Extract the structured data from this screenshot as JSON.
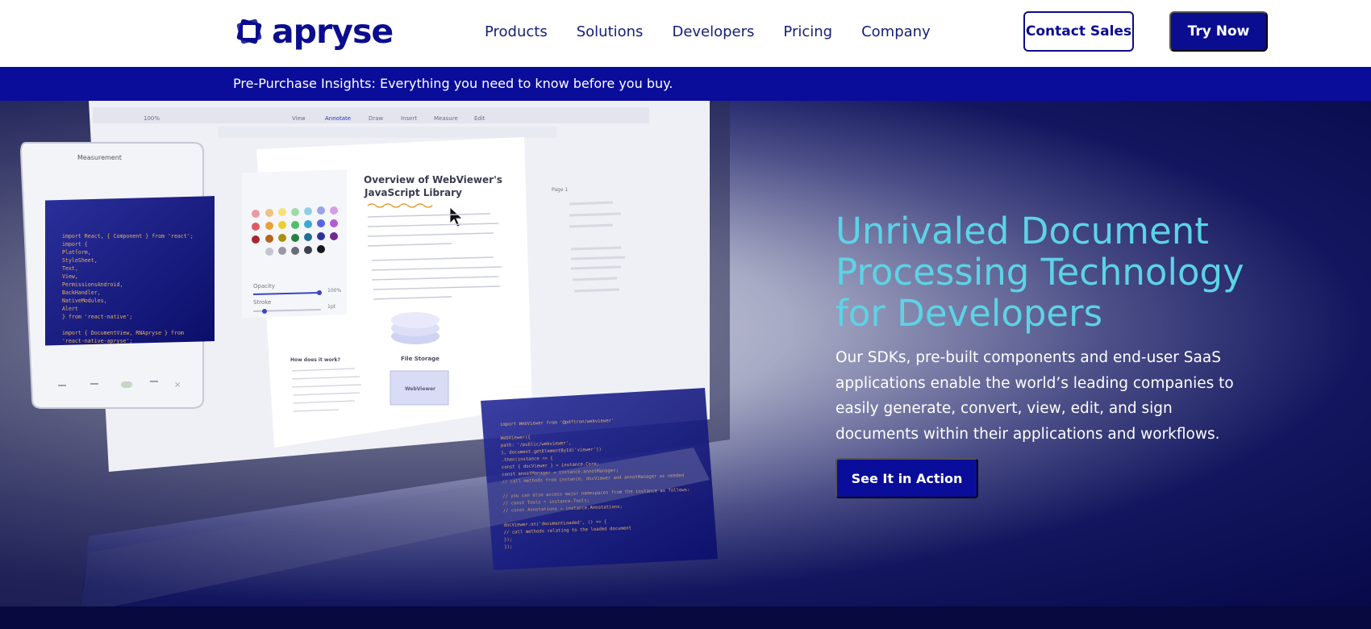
{
  "brand": {
    "name": "apryse",
    "color": "#0a0d8f"
  },
  "nav": {
    "items": [
      "Products",
      "Solutions",
      "Developers",
      "Pricing",
      "Company"
    ]
  },
  "header_buttons": {
    "contact": "Contact Sales",
    "try": "Try Now"
  },
  "banner": {
    "text": "Pre-Purchase Insights: Everything you need to know before you buy."
  },
  "hero": {
    "title_lines": [
      "Unrivaled Document",
      "Processing Technology",
      "for Developers"
    ],
    "description": "Our SDKs, pre-built components and end-user SaaS applications enable the world’s leading companies to easily generate, convert, view, edit, and sign documents within their applications and workflows.",
    "cta": "See It in Action",
    "title_color": "#5dd3e6"
  },
  "illustration": {
    "doc_title_1": "Overview of WebViewer's",
    "doc_title_2": "JavaScript Library",
    "panel_label": "Measurement",
    "toolbar_tabs": [
      "View",
      "Annotate",
      "Draw",
      "Insert",
      "Measure",
      "Edit"
    ],
    "zoom": "100%",
    "file_storage": "File Storage",
    "webviewer": "WebViewer",
    "how_it_works": "How does it work?",
    "page_label": "Page 1",
    "opacity_label": "Opacity",
    "stroke_label": "Stroke",
    "opacity_value": "100%",
    "stroke_value": "1pt",
    "code_left": [
      "import React, { Component } from 'react';",
      "import {",
      "  Platform,",
      "  StyleSheet,",
      "  Text,",
      "  View,",
      "  PermissionsAndroid,",
      "  BackHandler,",
      "  NativeModules,",
      "  Alert",
      "} from 'react-native';",
      "",
      "import { DocumentView, RNApryse } from",
      "'react-native-apryse';"
    ],
    "code_right": [
      "import WebViewer from '@pdftron/webviewer'",
      "",
      "WebViewer({",
      "  path: '/public/webviewer',",
      "}, document.getElementById('viewer'))",
      "  .then(instance => {",
      "    const { docViewer } = instance.Core;",
      "    const annotManager = instance.annotManager;",
      "    // call methods from instance, docViewer and annotManager as needed",
      "",
      "    // you can also access major namespaces from the instance as follows:",
      "    // const Tools = instance.Tools;",
      "    // const Annotations = instance.Annotations;",
      "",
      "    docViewer.on('documentLoaded', () => {",
      "      // call methods relating to the loaded document",
      "    });",
      "  });"
    ]
  }
}
